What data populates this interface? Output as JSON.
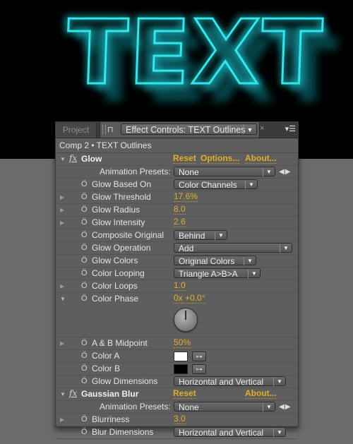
{
  "composition": {
    "preview_text": "TEXT",
    "glow_color": "#32e6ee"
  },
  "panel": {
    "tabs": {
      "project": "Project",
      "active": "Effect Controls: TEXT Outlines"
    },
    "breadcrumb": "Comp 2 • TEXT Outlines",
    "accent_color": "#e3ae2a"
  },
  "glow": {
    "name": "Glow",
    "fx": "fx",
    "reset": "Reset",
    "options": "Options...",
    "about": "About...",
    "presets_label": "Animation Presets:",
    "presets_value": "None",
    "props": {
      "based_on": {
        "label": "Glow Based On",
        "value": "Color Channels"
      },
      "threshold": {
        "label": "Glow Threshold",
        "value": "17.6%"
      },
      "radius": {
        "label": "Glow Radius",
        "value": "8.0"
      },
      "intensity": {
        "label": "Glow Intensity",
        "value": "2.6"
      },
      "composite": {
        "label": "Composite Original",
        "value": "Behind"
      },
      "operation": {
        "label": "Glow Operation",
        "value": "Add"
      },
      "colors": {
        "label": "Glow Colors",
        "value": "Original Colors"
      },
      "looping": {
        "label": "Color Looping",
        "value": "Triangle A>B>A"
      },
      "loops": {
        "label": "Color Loops",
        "value": "1.0"
      },
      "phase": {
        "label": "Color Phase",
        "value": "0x +0.0°",
        "dial_degrees": 0
      },
      "midpoint": {
        "label": "A & B Midpoint",
        "value": "50%"
      },
      "color_a": {
        "label": "Color A",
        "value": "#ffffff"
      },
      "color_b": {
        "label": "Color B",
        "value": "#000000"
      },
      "dimensions": {
        "label": "Glow Dimensions",
        "value": "Horizontal and Vertical"
      }
    }
  },
  "blur": {
    "name": "Gaussian Blur",
    "fx": "fx",
    "reset": "Reset",
    "about": "About...",
    "presets_label": "Animation Presets:",
    "presets_value": "None",
    "props": {
      "blurriness": {
        "label": "Blurriness",
        "value": "3.0"
      },
      "dimensions": {
        "label": "Blur Dimensions",
        "value": "Horizontal and Vertical"
      }
    }
  },
  "icons": {
    "triangle_right": "▶",
    "triangle_down": "▼",
    "dropdown_arrow": "▼",
    "stopwatch": "Ö",
    "close": "×",
    "panel_menu": "▾☰",
    "nav_prev_next": "◀▶",
    "lock": "🔓︎",
    "eyedropper": "⊶"
  }
}
